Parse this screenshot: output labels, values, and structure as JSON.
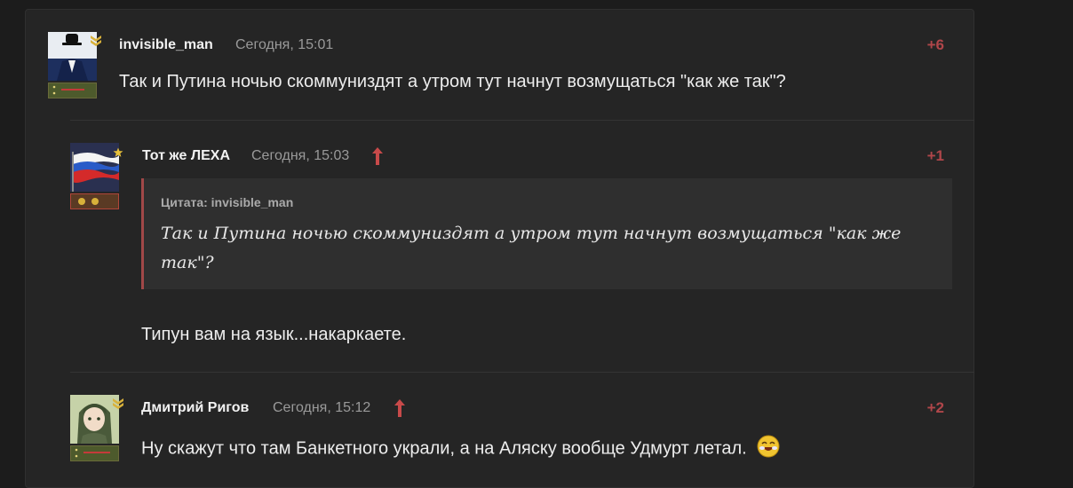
{
  "comments": [
    {
      "username": "invisible_man",
      "time": "Сегодня, 15:01",
      "score": "+6",
      "text": "Так и Путина ночью скоммуниздят а утром тут начнут возмущаться \"как же так\"?",
      "avatar_icon": "bowler-hat-man-avatar",
      "rank_icon": "chevrons-rank-icon"
    },
    {
      "username": "Тот же ЛЕХА",
      "time": "Сегодня, 15:03",
      "score": "+1",
      "quote_author": "Цитата: invisible_man",
      "quote_text": "Так и Путина ночью скоммуниздят а утром тут начнут возмущаться \"как же так\"?",
      "text": "Типун вам на язык...накаркаете.",
      "avatar_icon": "russian-flag-avatar",
      "rank_icon": "star-rank-icon"
    },
    {
      "username": "Дмитрий Ригов",
      "time": "Сегодня, 15:12",
      "score": "+2",
      "text": "Ну скажут что там Банкетного украли, а на Аляску вообще Удмурт летал.",
      "avatar_icon": "anime-girl-avatar",
      "rank_icon": "chevrons-rank-icon",
      "emoji": "laughing-emoji-icon"
    }
  ],
  "colors": {
    "background": "#1c1c1c",
    "panel": "#252525",
    "score": "#b0464a",
    "quote_border": "#a14848"
  }
}
